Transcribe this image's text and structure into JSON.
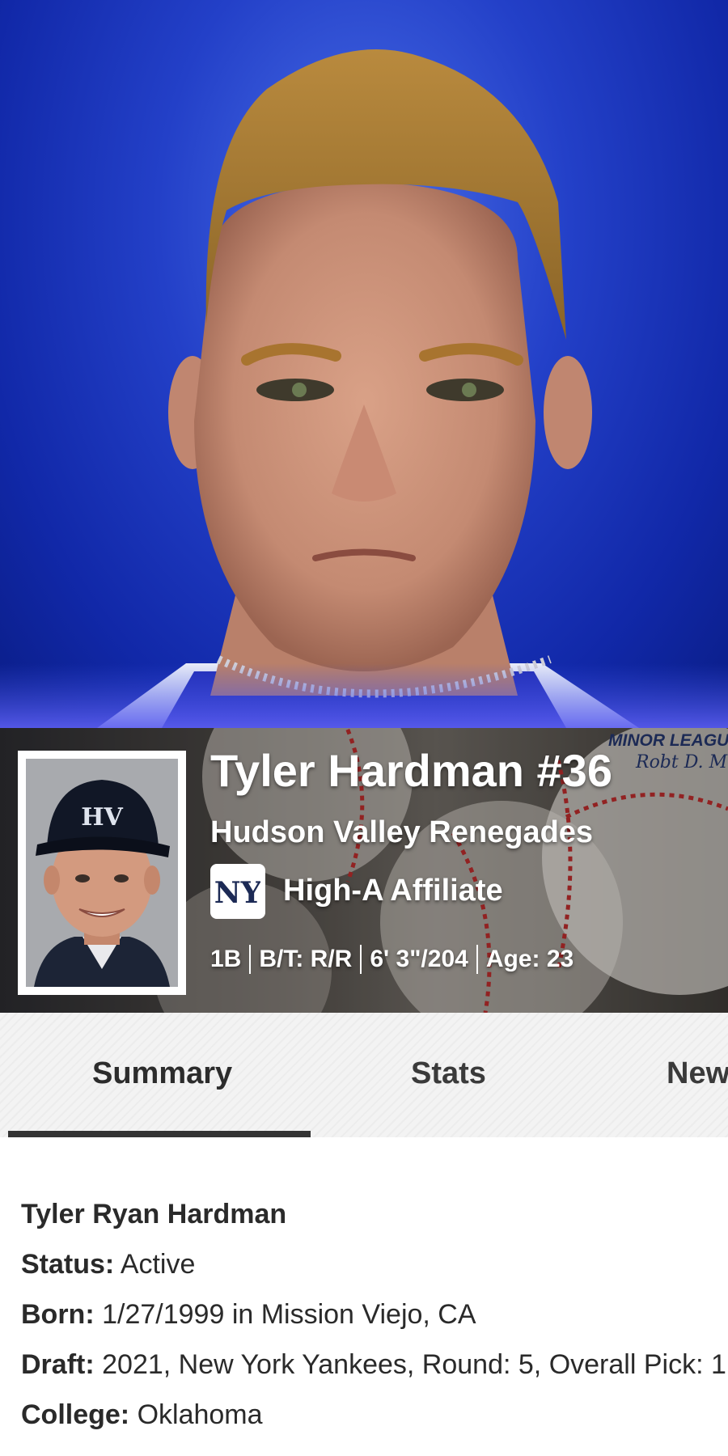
{
  "hero": {
    "alt": "player-portrait"
  },
  "banner": {
    "player_name": "Tyler Hardman #36",
    "team": "Hudson Valley Renegades",
    "affiliate": "High-A Affiliate",
    "stamp_title": "MINOR LEAGUE",
    "stamp_signature": "Robt D. Mo",
    "bio": {
      "position": "1B",
      "bats_throws": "B/T: R/R",
      "height_weight": "6' 3\"/204",
      "age": "Age: 23"
    },
    "cap_logo": "HV",
    "affiliate_logo": "NY"
  },
  "tabs": [
    {
      "label": "Summary",
      "active": true
    },
    {
      "label": "Stats",
      "active": false
    },
    {
      "label": "New",
      "active": false
    }
  ],
  "summary": {
    "full_name": "Tyler Ryan Hardman",
    "status_label": "Status:",
    "status_value": "Active",
    "born_label": "Born:",
    "born_value": "1/27/1999 in Mission Viejo, CA",
    "draft_label": "Draft:",
    "draft_value": "2021, New York Yankees, Round: 5, Overall Pick: 1",
    "college_label": "College:",
    "college_value": "Oklahoma"
  },
  "colors": {
    "accent_tab": "#333333",
    "hero_bg": "#1f3cc4"
  }
}
